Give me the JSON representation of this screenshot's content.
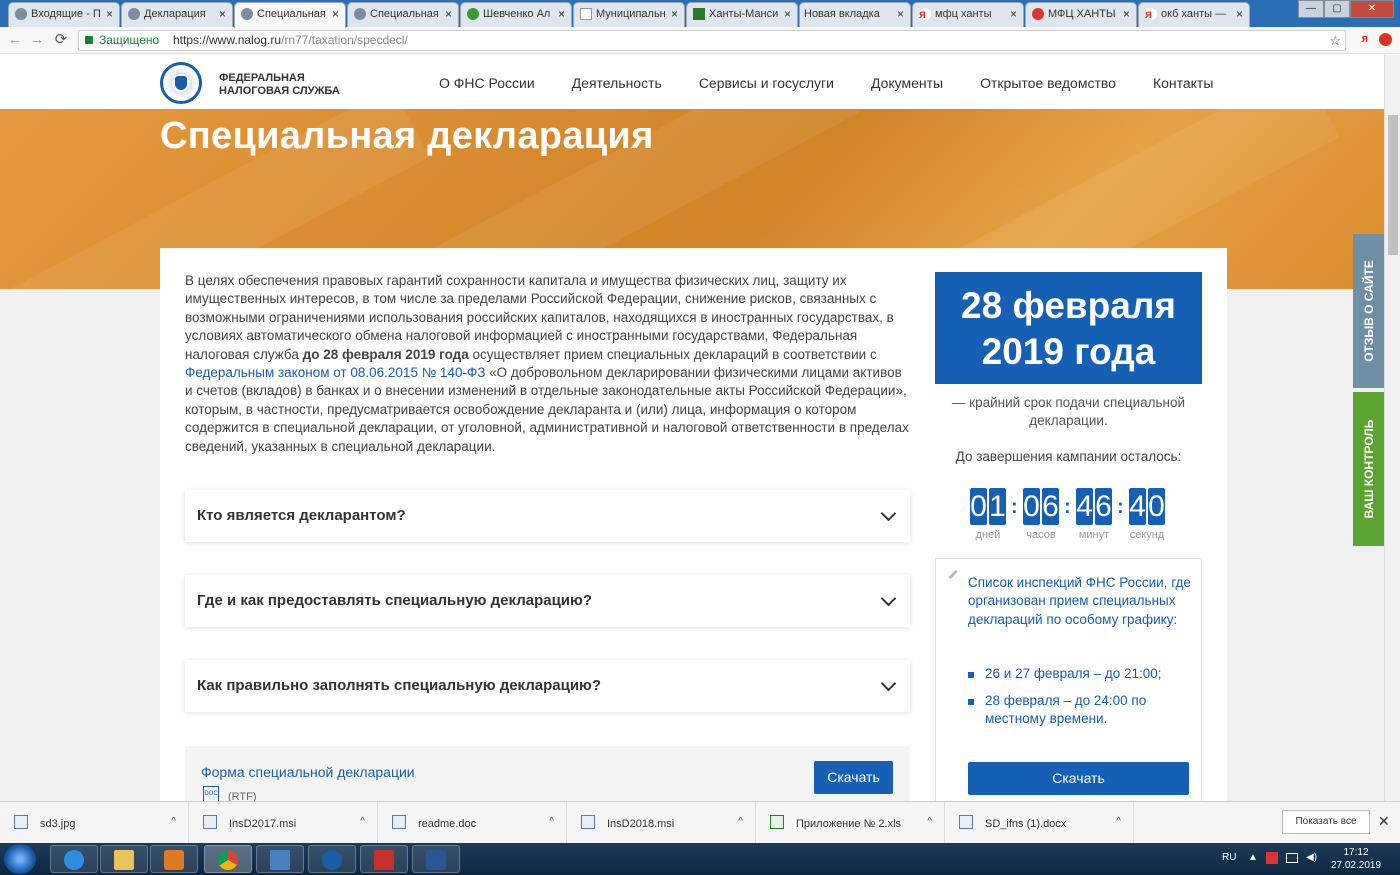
{
  "browser": {
    "tabs": [
      {
        "label": "Входящие - П",
        "active": false
      },
      {
        "label": "Декларация",
        "active": false
      },
      {
        "label": "Специальная",
        "active": true
      },
      {
        "label": "Специальная",
        "active": false
      },
      {
        "label": "Шевченко Ал",
        "active": false
      },
      {
        "label": "Муниципальн",
        "active": false
      },
      {
        "label": "Ханты-Манси",
        "active": false
      },
      {
        "label": "Новая вкладка",
        "active": false
      },
      {
        "label": "мфц ханты",
        "active": false
      },
      {
        "label": "МФЦ ХАНТЫ",
        "active": false
      },
      {
        "label": "окб ханты —",
        "active": false
      }
    ],
    "tab_close": "×",
    "secure_label": "Защищено",
    "url_host": "https://www.nalog.ru",
    "url_path": "/rn77/taxation/specdecl/",
    "back": "←",
    "forward": "→",
    "reload": "⟳",
    "star": "☆",
    "ya": "я",
    "min": "—",
    "max": "▢",
    "close": "✕"
  },
  "site": {
    "logo_line1": "ФЕДЕРАЛЬНАЯ",
    "logo_line2": "НАЛОГОВАЯ СЛУЖБА",
    "nav": [
      "О ФНС России",
      "Деятельность",
      "Сервисы и госуслуги",
      "Документы",
      "Открытое ведомство",
      "Контакты"
    ]
  },
  "hero": {
    "title": "Специальная декларация"
  },
  "intro": {
    "part1": "В целях обеспечения правовых гарантий сохранности капитала и имущества физических лиц, защиту их имущественных интересов, в том числе за пределами Российской Федерации, снижение рисков, связанных с возможными ограничениями использования российских капиталов, находящихся в иностранных государствах, в условиях автоматического обмена налоговой информацией с иностранными государствами, Федеральная налоговая служба ",
    "bold": "до 28 февраля 2019 года",
    "part2": " осуществляет прием специальных деклараций в соответствии с ",
    "link": "Федеральным законом от 08.06.2015 № 140-ФЗ",
    "part3": " «О добровольном декларировании физическими лицами активов и счетов (вкладов) в банках и о внесении изменений в отдельные законодательные акты Российской Федерации», которым, в частности, предусматривается освобождение декларанта и (или) лица, информация о котором содержится в специальной декларации, от уголовной, административной и налоговой ответственности в пределах сведений, указанных в специальной декларации."
  },
  "accordion": [
    {
      "question": "Кто является декларантом?"
    },
    {
      "question": "Где и как предоставлять специальную декларацию?"
    },
    {
      "question": "Как правильно заполнять специальную декларацию?"
    }
  ],
  "form": {
    "link": "Форма специальной декларации",
    "doc_badge": "DOC",
    "format": "(RTF)",
    "download": "Скачать"
  },
  "deadline": {
    "line1": "28 февраля",
    "line2": "2019 года",
    "caption": "— крайний срок подачи специальной декларации.",
    "countdown_label": "До завершения кампании осталось:",
    "countdown": [
      {
        "value": "01",
        "unit": "дней"
      },
      {
        "value": "06",
        "unit": "часов"
      },
      {
        "value": "46",
        "unit": "минут"
      },
      {
        "value": "40",
        "unit": "секунд"
      }
    ],
    "sep": ":"
  },
  "inspections": {
    "title": "Список инспекций ФНС России, где организован прием специальных деклараций по особому графику:",
    "items": [
      "26 и 27 февраля – до 21:00;",
      "28 февраля – до 24:00 по местному времени."
    ],
    "download": "Скачать"
  },
  "side_tabs": {
    "feedback": "ОТЗЫВ О САЙТЕ",
    "control": "ВАШ КОНТРОЛЬ"
  },
  "downloads": {
    "items": [
      "sd3.jpg",
      "InsD2017.msi",
      "readme.doc",
      "InsD2018.msi",
      "Приложение № 2.xls",
      "SD_ifns (1).docx"
    ],
    "caret": "^",
    "show_all": "Показать все",
    "close": "✕"
  },
  "taskbar": {
    "lang": "RU",
    "arrow": "▲",
    "volume": "◀)",
    "time": "17:12",
    "date": "27.02.2019"
  },
  "colors": {
    "brand_blue": "#1560b5",
    "hero_orange": "#d88b2e",
    "feedback_tab": "#6f8fa7",
    "control_tab": "#5aa52f"
  }
}
